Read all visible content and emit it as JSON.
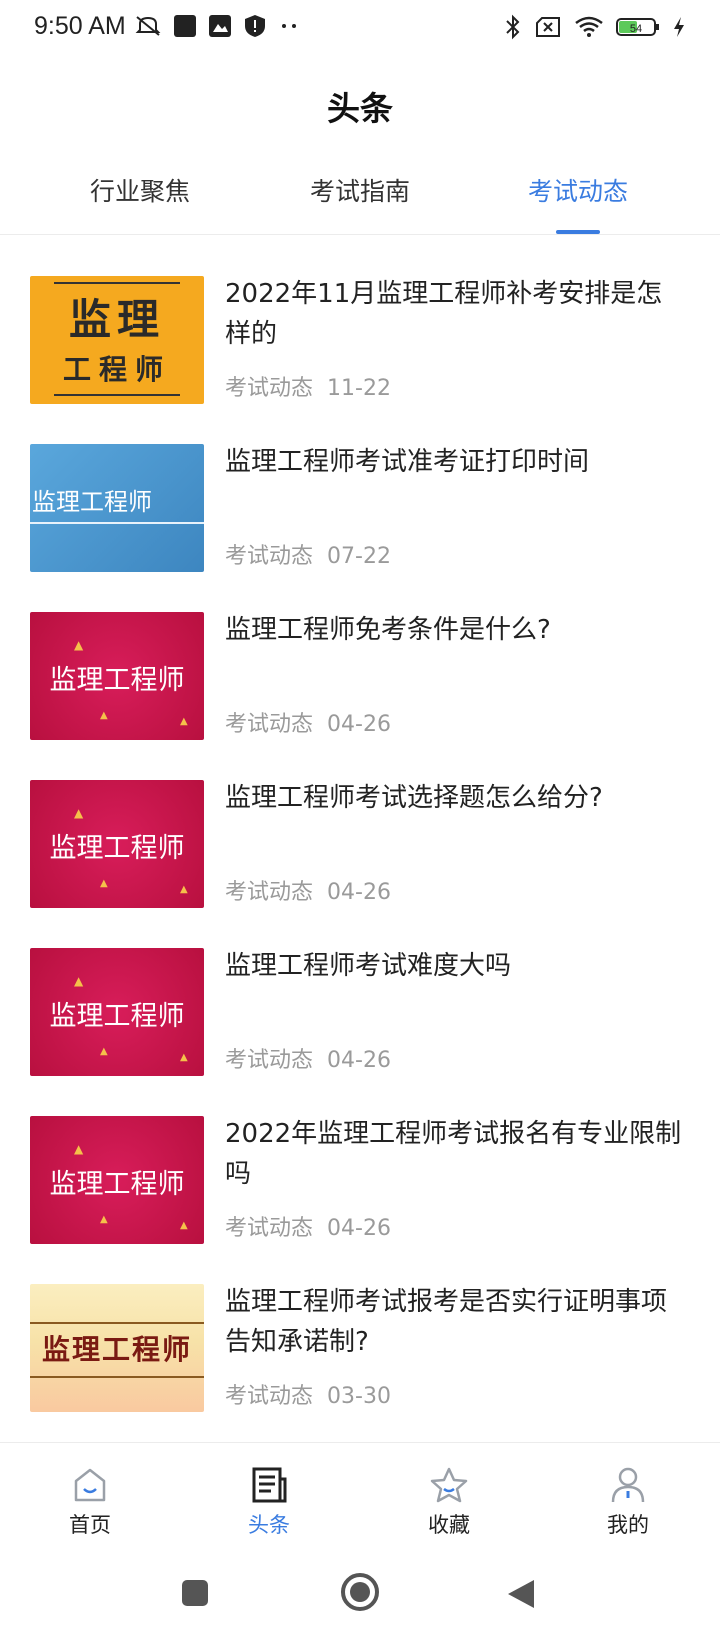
{
  "status_bar": {
    "time": "9:50 AM",
    "battery": "54"
  },
  "header": {
    "title": "头条"
  },
  "tabs": [
    {
      "label": "行业聚焦",
      "active": false
    },
    {
      "label": "考试指南",
      "active": false
    },
    {
      "label": "考试动态",
      "active": true
    }
  ],
  "articles": [
    {
      "title": "2022年11月监理工程师补考安排是怎样的",
      "category": "考试动态",
      "date": "11-22",
      "thumb": "yellow",
      "thumb_text": "监理 工程师"
    },
    {
      "title": "监理工程师考试准考证打印时间",
      "category": "考试动态",
      "date": "07-22",
      "thumb": "blue",
      "thumb_text": "监理工程师"
    },
    {
      "title": "监理工程师免考条件是什么?",
      "category": "考试动态",
      "date": "04-26",
      "thumb": "red",
      "thumb_text": "监理工程师"
    },
    {
      "title": "监理工程师考试选择题怎么给分?",
      "category": "考试动态",
      "date": "04-26",
      "thumb": "red",
      "thumb_text": "监理工程师"
    },
    {
      "title": "监理工程师考试难度大吗",
      "category": "考试动态",
      "date": "04-26",
      "thumb": "red",
      "thumb_text": "监理工程师"
    },
    {
      "title": "2022年监理工程师考试报名有专业限制吗",
      "category": "考试动态",
      "date": "04-26",
      "thumb": "red",
      "thumb_text": "监理工程师"
    },
    {
      "title": "监理工程师考试报考是否实行证明事项告知承诺制?",
      "category": "考试动态",
      "date": "03-30",
      "thumb": "cream",
      "thumb_text": "监理工程师"
    }
  ],
  "bottom_nav": [
    {
      "label": "首页",
      "icon": "home-icon",
      "active": false
    },
    {
      "label": "头条",
      "icon": "news-icon",
      "active": true
    },
    {
      "label": "收藏",
      "icon": "star-icon",
      "active": false
    },
    {
      "label": "我的",
      "icon": "user-icon",
      "active": false
    }
  ],
  "colors": {
    "accent": "#3a7ce0",
    "thumb_yellow": "#f5a91f",
    "thumb_blue": "#4a9bd4",
    "thumb_red": "#c8124a",
    "thumb_cream": "#f6e3b0"
  }
}
